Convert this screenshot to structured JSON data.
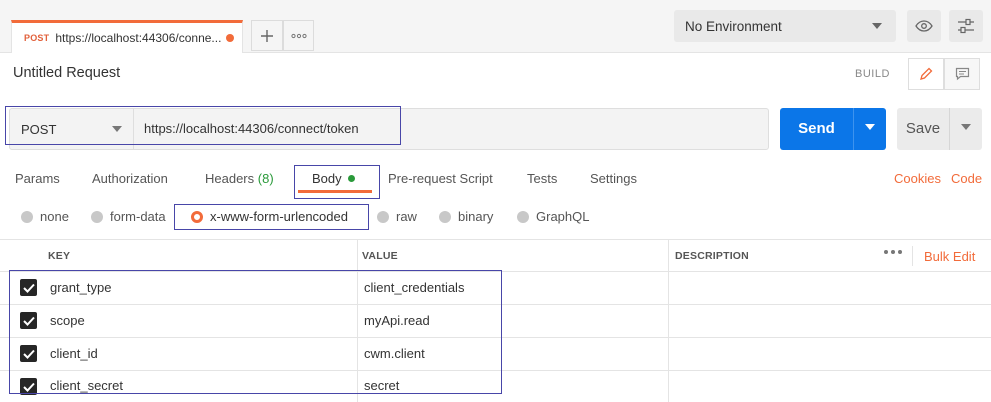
{
  "tab": {
    "method": "POST",
    "url": "https://localhost:44306/conne..."
  },
  "environment": {
    "selected": "No Environment"
  },
  "request": {
    "title": "Untitled Request",
    "build_label": "BUILD"
  },
  "urlbar": {
    "method": "POST",
    "url": "https://localhost:44306/connect/token",
    "send_label": "Send",
    "save_label": "Save"
  },
  "subtabs": {
    "params": "Params",
    "authorization": "Authorization",
    "headers": "Headers",
    "headers_count": "(8)",
    "body": "Body",
    "prerequest": "Pre-request Script",
    "tests": "Tests",
    "settings": "Settings",
    "cookies": "Cookies",
    "code": "Code"
  },
  "body_modes": {
    "none": "none",
    "form_data": "form-data",
    "urlencoded": "x-www-form-urlencoded",
    "raw": "raw",
    "binary": "binary",
    "graphql": "GraphQL",
    "selected": "x-www-form-urlencoded"
  },
  "table": {
    "headers": {
      "key": "KEY",
      "value": "VALUE",
      "description": "DESCRIPTION"
    },
    "bulk_edit": "Bulk Edit",
    "rows": [
      {
        "checked": true,
        "key": "grant_type",
        "value": "client_credentials"
      },
      {
        "checked": true,
        "key": "scope",
        "value": "myApi.read"
      },
      {
        "checked": true,
        "key": "client_id",
        "value": "cwm.client"
      },
      {
        "checked": true,
        "key": "client_secret",
        "value": "secret"
      }
    ]
  },
  "colors": {
    "accent": "#f26b3a",
    "send": "#0b76e8",
    "success": "#2a9a3a",
    "highlight": "#4846a8"
  }
}
